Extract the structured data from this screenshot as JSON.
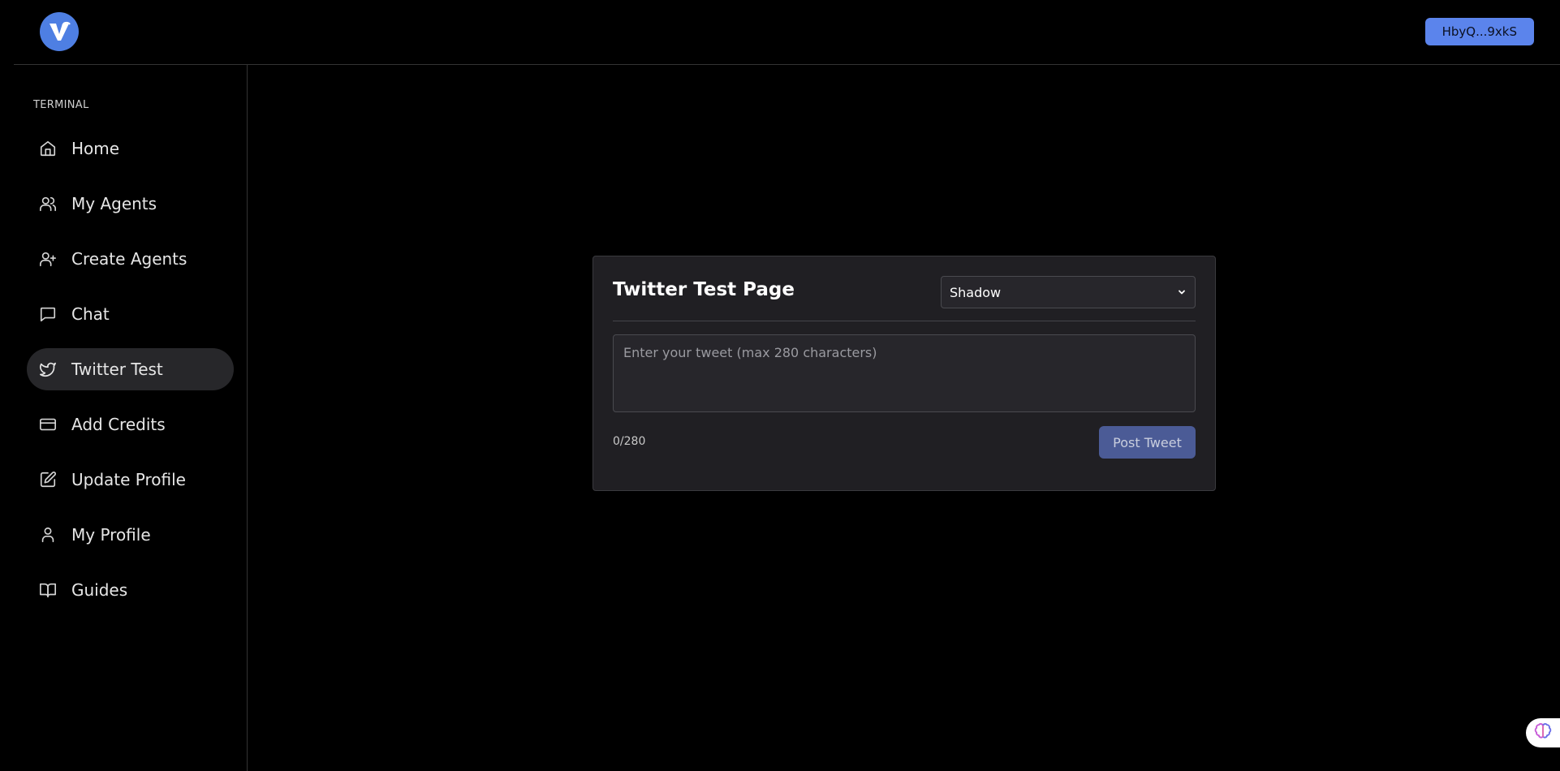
{
  "header": {
    "logo_letter": "V",
    "wallet_label": "HbyQ...9xkS",
    "accent_color": "#5b84ec"
  },
  "sidebar": {
    "section_label": "TERMINAL",
    "items": [
      {
        "label": "Home",
        "icon": "home-icon",
        "active": false
      },
      {
        "label": "My Agents",
        "icon": "users-icon",
        "active": false
      },
      {
        "label": "Create Agents",
        "icon": "user-plus-icon",
        "active": false
      },
      {
        "label": "Chat",
        "icon": "chat-icon",
        "active": false
      },
      {
        "label": "Twitter Test",
        "icon": "twitter-icon",
        "active": true
      },
      {
        "label": "Add Credits",
        "icon": "credit-card-icon",
        "active": false
      },
      {
        "label": "Update Profile",
        "icon": "edit-icon",
        "active": false
      },
      {
        "label": "My Profile",
        "icon": "user-icon",
        "active": false
      },
      {
        "label": "Guides",
        "icon": "book-icon",
        "active": false
      }
    ]
  },
  "card": {
    "title": "Twitter Test Page",
    "select_value": "Shadow",
    "textarea_placeholder": "Enter your tweet (max 280 characters)",
    "counter": "0/280",
    "post_label": "Post Tweet"
  },
  "widget": {
    "icon": "brain-icon"
  }
}
